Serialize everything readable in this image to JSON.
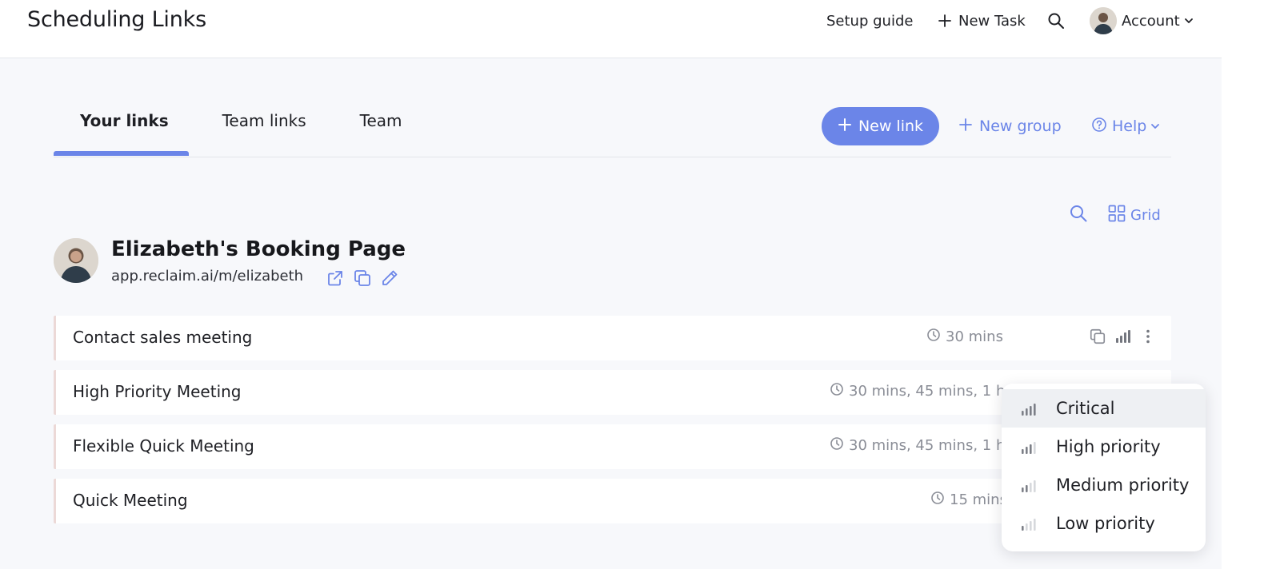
{
  "header": {
    "title": "Scheduling Links",
    "setup_guide": "Setup guide",
    "new_task": "New Task",
    "account": "Account"
  },
  "tabs": [
    {
      "label": "Your links",
      "active": true
    },
    {
      "label": "Team links",
      "active": false
    },
    {
      "label": "Team",
      "active": false
    }
  ],
  "actions": {
    "new_link": "New link",
    "new_group": "New group",
    "help": "Help"
  },
  "view": {
    "grid_label": "Grid"
  },
  "booking_page": {
    "name": "Elizabeth's Booking Page",
    "url": "app.reclaim.ai/m/elizabeth"
  },
  "links": [
    {
      "title": "Contact sales meeting",
      "durations": "30 mins"
    },
    {
      "title": "High Priority Meeting",
      "durations": "30 mins, 45 mins, 1 hr"
    },
    {
      "title": "Flexible Quick Meeting",
      "durations": "30 mins, 45 mins, 1 hr"
    },
    {
      "title": "Quick Meeting",
      "durations": "15 mins"
    }
  ],
  "priority_menu": [
    {
      "label": "Critical",
      "level": 4
    },
    {
      "label": "High priority",
      "level": 3
    },
    {
      "label": "Medium priority",
      "level": 2
    },
    {
      "label": "Low priority",
      "level": 1
    }
  ],
  "colors": {
    "accent": "#6b85e8",
    "text": "#1e1f24",
    "muted": "#8a8d96",
    "row_marker": "#ecd9d7"
  }
}
